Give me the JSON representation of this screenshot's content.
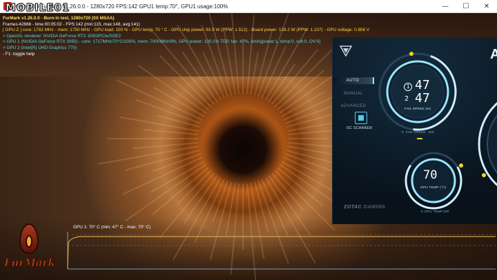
{
  "window": {
    "title": "Geeks3D FurMark v1.26.0.0 - 1280x720 FPS:142 GPU1 temp:70°, GPU1 usage:100%",
    "minimize_glyph": "—",
    "maximize_glyph": "☐",
    "close_glyph": "✕"
  },
  "watermark": "MOBILE01",
  "overlay": {
    "lines": [
      "FurMark v1.26.0.0 - Burn-in test, 1280x720 (0X MSAA)",
      "Frames:42666 - time:00:05:02 - FPS:142 (min:115, max:148, avg:141)",
      "[ GPU-Z ] core: 1782 MHz - mem: 1750 MHz - GPU load: 100 % - GPU temp: 70 ° C - GPU chip power: 93.9 W (PPW: 1.512) - Board power: 128.2 W (PPW: 1.107) - GPU voltage: 0.856 V",
      "> OpenGL renderer: NVIDIA GeForce RTX 3050/PCIe/SSE2",
      "> GPU 1 (NVIDIA GeForce RTX 3050) - core: 1717MHz/70°C/100%, mem: 7000MHz/9%, GPU power: 100.1% TDP, fan: 47%, limits[power:1, temp:0, volt:0, OV:0]",
      "> GPU 2 (Intel(R) UHD Graphics 770)",
      "- F1: toggle help"
    ]
  },
  "logo_text": "FurMark",
  "graph": {
    "label": "GPU 1: 70° C (min: 47° C - max: 70° C)",
    "min_temp": 47,
    "max_temp": 70,
    "current_temp": 70,
    "line_color": "#d8a04a",
    "axis_color": "#6fa0c8"
  },
  "zotac_panel": {
    "modes": [
      "AUTO",
      "MANUAL",
      "ADVANCED"
    ],
    "active_mode": "AUTO",
    "oc_scanner_label": "OC SCANNER",
    "fan1_label": "1",
    "fan1_value": "47",
    "fan2_label": "2",
    "fan2_value": "47",
    "fan_speed_label": "FAN SPEED (%)",
    "fan_scale_min": "0",
    "fan_scale_caption": "FAN SPEED",
    "fan_scale_max": "100",
    "gpu_temp_value": "70",
    "gpu_temp_label": "GPU TEMP (°C)",
    "temp_scale_min": "0",
    "temp_scale_caption": "GPU TEMP",
    "temp_scale_max": "100",
    "brand_left": "ZOTAC",
    "brand_right": "GAMING",
    "accent": "#9be7ff",
    "dot_color": "#f2d22a"
  }
}
